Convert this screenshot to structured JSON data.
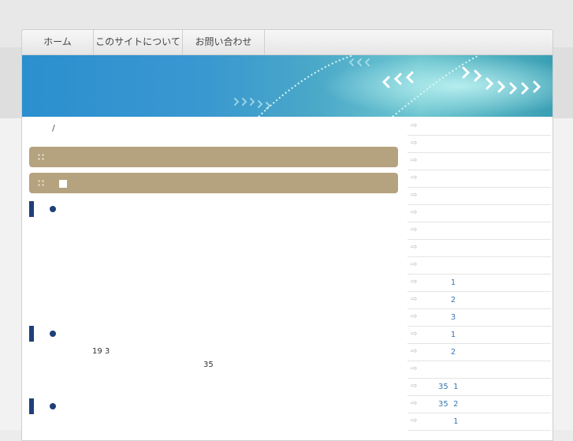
{
  "nav": {
    "items": [
      {
        "label": "ホーム"
      },
      {
        "label": "このサイトについて"
      },
      {
        "label": "お問い合わせ"
      }
    ]
  },
  "breadcrumb": {
    "separator": "/"
  },
  "content": {
    "text_line1": "19 3",
    "text_line2": "35"
  },
  "sidebar": {
    "items": [
      {
        "label": ""
      },
      {
        "label": ""
      },
      {
        "label": ""
      },
      {
        "label": ""
      },
      {
        "label": ""
      },
      {
        "label": ""
      },
      {
        "label": ""
      },
      {
        "label": ""
      },
      {
        "label": ""
      },
      {
        "label": "     1"
      },
      {
        "label": "     2"
      },
      {
        "label": "     3"
      },
      {
        "label": "     1"
      },
      {
        "label": "     2"
      },
      {
        "label": ""
      },
      {
        "label": "35  1"
      },
      {
        "label": "35  2"
      },
      {
        "label": "      1"
      }
    ]
  },
  "colors": {
    "bar": "#b5a27f",
    "heading_accent": "#1e3f7a",
    "link": "#3a78b5",
    "banner": "#2b8fcf"
  },
  "icons": {
    "bar_grip": "grip-dots-icon",
    "side_arrow": "arrow-right-icon"
  }
}
